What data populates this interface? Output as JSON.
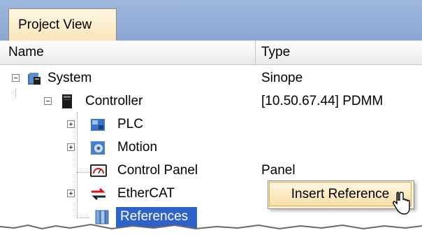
{
  "tab": {
    "label": "Project View"
  },
  "columns": {
    "name": "Name",
    "type": "Type"
  },
  "tree": [
    {
      "label": "System",
      "type": "Sinope",
      "icon": "system-icon"
    },
    {
      "label": "Controller",
      "type": "[10.50.67.44] PDMM",
      "icon": "controller-icon"
    },
    {
      "label": "PLC",
      "type": "",
      "icon": "plc-icon"
    },
    {
      "label": "Motion",
      "type": "",
      "icon": "motion-icon"
    },
    {
      "label": "Control Panel",
      "type": "Panel",
      "icon": "control-panel-icon"
    },
    {
      "label": "EtherCAT",
      "type": "",
      "icon": "ethercat-icon"
    },
    {
      "label": "References",
      "type": "",
      "icon": "references-icon",
      "selected": true
    }
  ],
  "context_menu": {
    "items": [
      {
        "label": "Insert Reference"
      }
    ]
  },
  "colors": {
    "selection": "#2d63c8",
    "tab_strip": "#8aa6d2",
    "menu_bg": "#fff3d6"
  }
}
